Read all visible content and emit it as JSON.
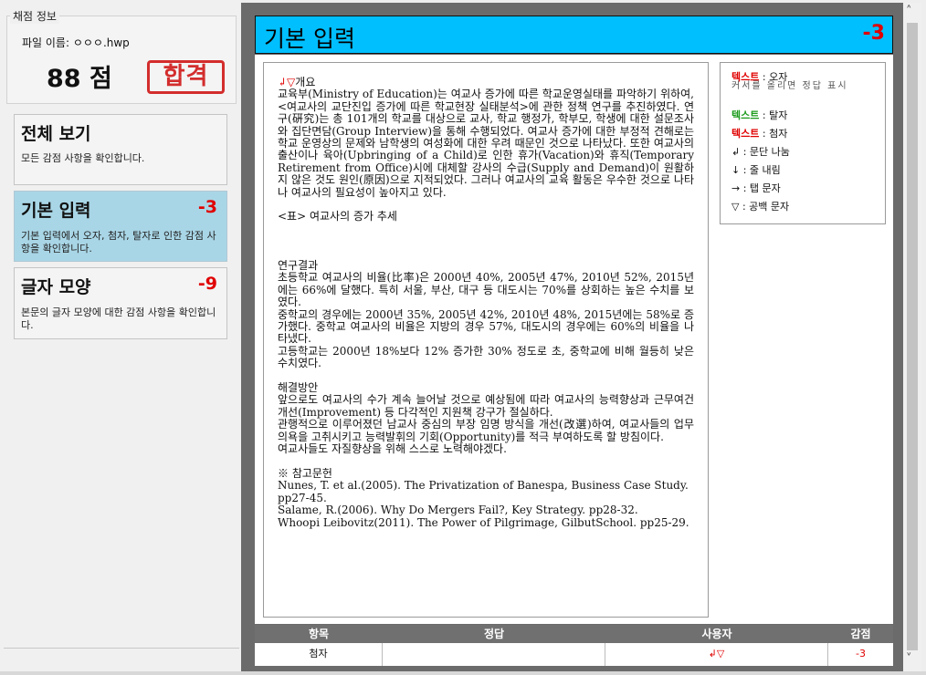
{
  "left": {
    "group_title": "채점 정보",
    "file_label": "파일 이름: ㅇㅇㅇ.hwp",
    "score": "88 점",
    "stamp": "합격",
    "cards": [
      {
        "title": "전체 보기",
        "points": "",
        "desc": "모든 감점 사항을 확인합니다."
      },
      {
        "title": "기본 입력",
        "points": "-3",
        "desc": "기본 입력에서 오자, 첨자, 탈자로 인한 감점 사항을 확인합니다."
      },
      {
        "title": "글자 모양",
        "points": "-9",
        "desc": "본문의 글자 모양에 대한 감점 사항을 확인합니다."
      }
    ]
  },
  "header": {
    "title": "기본 입력",
    "points": "-3"
  },
  "document": {
    "mark": "↲▽",
    "lines": [
      "개요",
      "교육부(Ministry of Education)는 여교사 증가에 따른 학교운영실태를 파악하기 위하여, <여교사의 교단진입 증가에 따른 학교현장 실태분석>에 관한 정책 연구를 추진하였다. 연구(硏究)는 총 101개의 학교를 대상으로 교사, 학교 행정가, 학부모, 학생에 대한 설문조사와 집단면담(Group Interview)을 통해 수행되었다. 여교사 증가에 대한 부정적 견해로는 학교 운영상의 문제와 남학생의 여성화에 대한 우려 때문인 것으로 나타났다. 또한 여교사의 출산이나 육아(Upbringing of a Child)로 인한 휴가(Vacation)와 휴직(Temporary Retirement from Office)시에 대체할 강사의 수급(Supply and Demand)이 원활하지 않은 것도 원인(原因)으로 지적되었다. 그러나 여교사의 교육 활동은 우수한 것으로 나타나 여교사의 필요성이 높아지고 있다.",
      "<표> 여교사의 증가 추세",
      "연구결과",
      "초등학교 여교사의 비율(比率)은 2000년 40%, 2005년 47%, 2010년 52%, 2015년에는 66%에 달했다. 특히 서울, 부산, 대구 등 대도시는 70%를 상회하는 높은 수치를 보였다.",
      "중학교의 경우에는 2000년 35%, 2005년 42%, 2010년 48%, 2015년에는 58%로 증가했다. 중학교 여교사의 비율은 지방의 경우 57%, 대도시의 경우에는 60%의 비율을 나타냈다.",
      "고등학교는 2000년 18%보다 12% 증가한 30% 정도로 초, 중학교에 비해 월등히 낮은 수치였다.",
      "해결방안",
      "앞으로도 여교사의 수가 계속 늘어날 것으로 예상됨에 따라 여교사의 능력향상과 근무여건 개선(Improvement) 등 다각적인 지원책 강구가 절실하다.",
      "관행적으로 이루어졌던 남교사 중심의 부장 임명 방식을 개선(改選)하여, 여교사들의 업무의욕을 고취시키고 능력발휘의 기회(Opportunity)를 적극 부여하도록 할 방침이다.",
      "여교사들도 자질향상을 위해 스스로 노력해야겠다.",
      "※ 참고문헌",
      "Nunes, T. et al.(2005). The Privatization of Banespa, Business Case Study. pp27-45.",
      "Salame, R.(2006). Why Do Mergers Fail?, Key Strategy. pp28-32.",
      "Whoopi Leibovitz(2011). The Power of Pilgrimage, GilbutSchool. pp25-29."
    ]
  },
  "legend": {
    "typo_word": "텍스트",
    "typo_label": " : 오자",
    "typo_hint": "커서를 올리면 정답 표시",
    "missing_word": "텍스트",
    "missing_label": " : 탈자",
    "sub_word": "텍스트",
    "sub_label": " : 첨자",
    "para": "↲ : 문단 나눔",
    "line": "↓ : 줄 내림",
    "tab": "→ : 탭 문자",
    "space": "▽ : 공백 문자"
  },
  "table": {
    "headers": [
      "항목",
      "정답",
      "사용자",
      "감점"
    ],
    "row": {
      "item": "첨자",
      "answer": "",
      "user": "↲▽",
      "points": "-3"
    }
  },
  "colors": {
    "header": "#00bfff",
    "active_card": "#a9d6e6",
    "penalty": "#e00000",
    "missing": "#1a9a1a"
  }
}
